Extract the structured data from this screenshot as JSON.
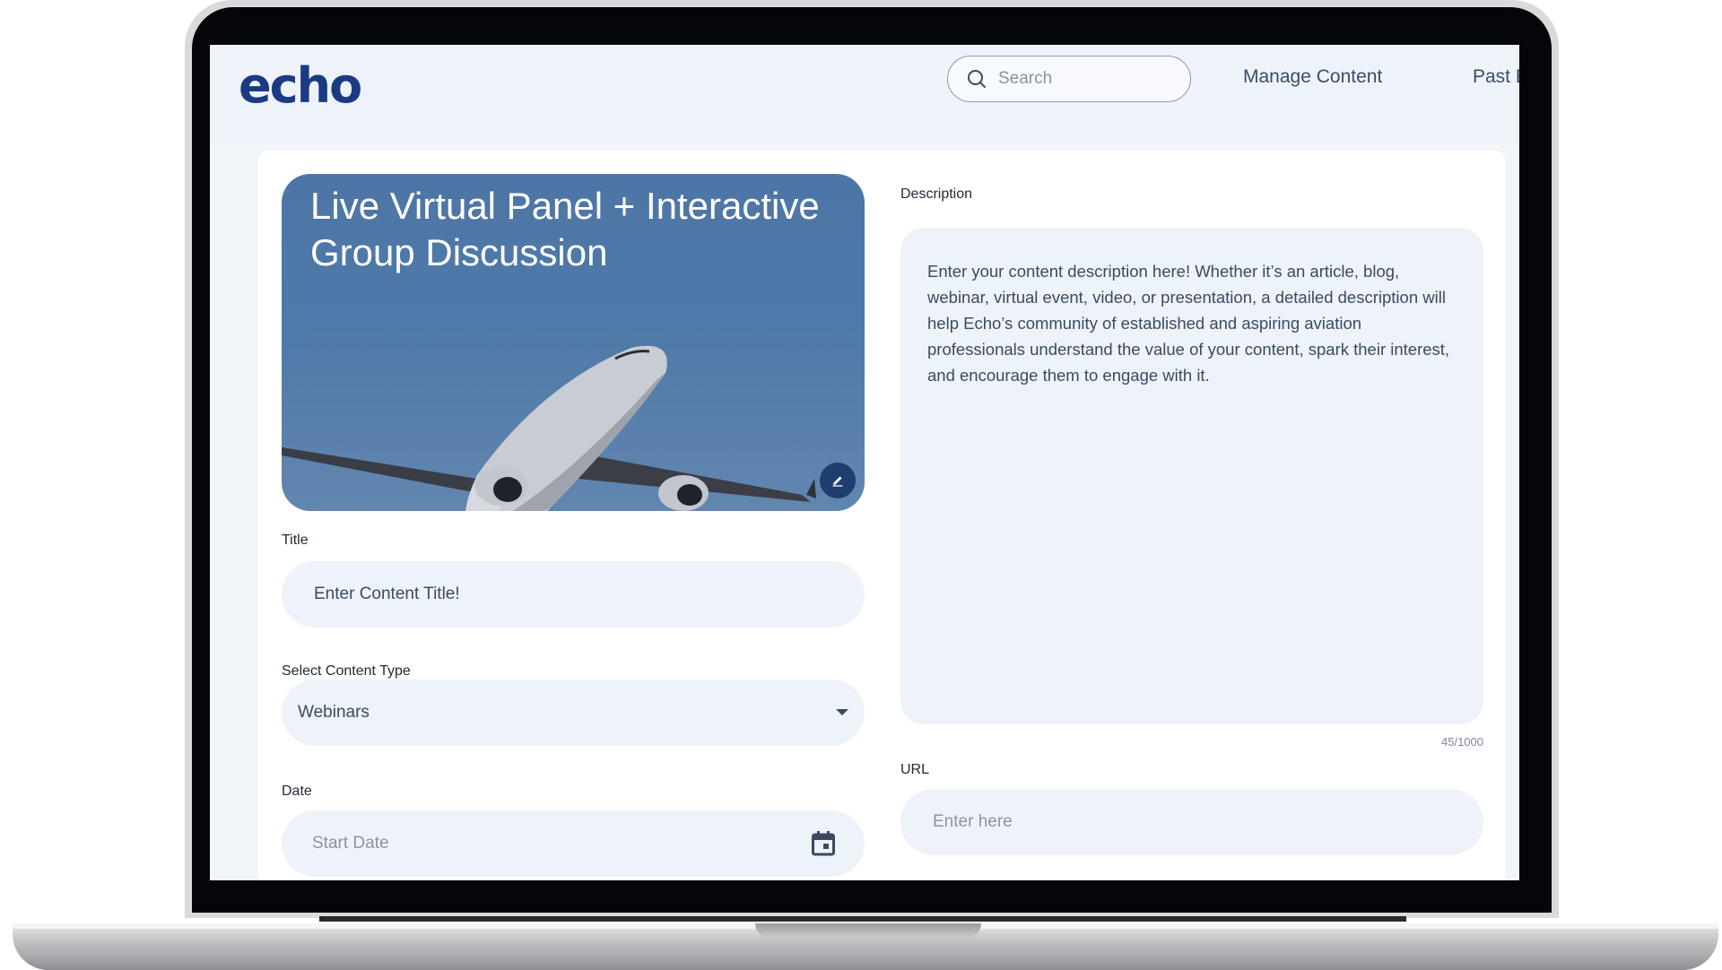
{
  "header": {
    "logo_text": "echo",
    "search_placeholder": "Search",
    "nav": [
      {
        "label": "Manage Content"
      },
      {
        "label": "Past Events"
      }
    ]
  },
  "hero": {
    "title": "Live Virtual Panel + Interactive Group Discussion"
  },
  "form": {
    "title_label": "Title",
    "title_placeholder": "Enter Content Title!",
    "content_type_label": "Select Content Type",
    "content_type_value": "Webinars",
    "date_label": "Date",
    "date_placeholder": "Start Date",
    "description_label": "Description",
    "description_text": "Enter your content description here! Whether it’s an article, blog, webinar, virtual event, video, or presentation, a detailed description will help Echo’s community of established and aspiring aviation professionals understand the value of your content, spark their interest, and encourage them to engage with it.",
    "char_count": "45/1000",
    "url_label": "URL",
    "url_placeholder": "Enter here"
  },
  "colors": {
    "brand": "#1b3a84",
    "field_bg": "#eef3f9",
    "hero_sky": "#4f79a8"
  }
}
